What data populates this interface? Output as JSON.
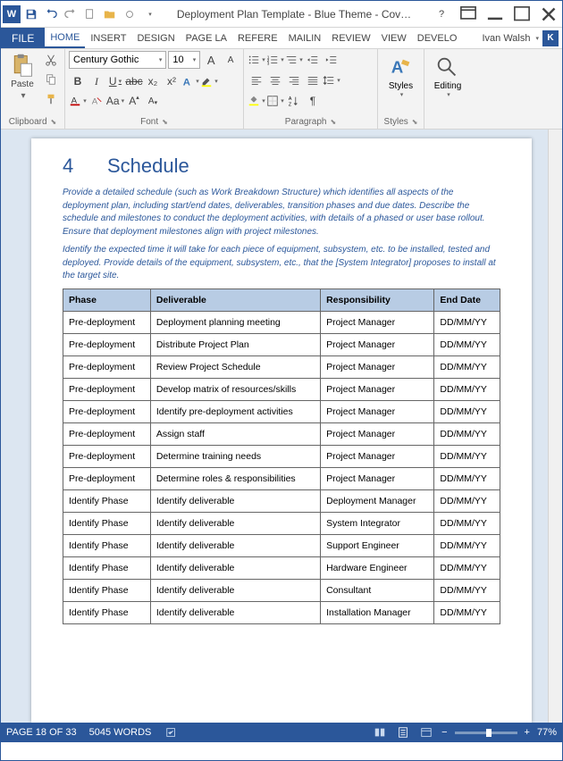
{
  "titlebar": {
    "title": "Deployment Plan Template - Blue Theme - Cov…"
  },
  "ribbon_tabs": {
    "file": "FILE",
    "items": [
      "HOME",
      "INSERT",
      "DESIGN",
      "PAGE LA",
      "REFERE",
      "MAILIN",
      "REVIEW",
      "VIEW",
      "DEVELO"
    ],
    "active_index": 0
  },
  "user": {
    "name": "Ivan Walsh",
    "initial": "K"
  },
  "ribbon": {
    "clipboard": {
      "label": "Clipboard",
      "paste": "Paste"
    },
    "font": {
      "label": "Font",
      "name": "Century Gothic",
      "size": "10",
      "bold": "B",
      "italic": "I",
      "underline": "U",
      "strike": "abc",
      "sub": "x₂",
      "sup": "x²",
      "grow": "A",
      "shrink": "A",
      "case": "Aa"
    },
    "paragraph": {
      "label": "Paragraph"
    },
    "styles": {
      "label": "Styles",
      "btn": "Styles"
    },
    "editing": {
      "label": "",
      "btn": "Editing"
    }
  },
  "document": {
    "heading_num": "4",
    "heading_text": "Schedule",
    "instr1": "Provide a detailed schedule (such as Work Breakdown Structure) which identifies all aspects of the deployment plan, including start/end dates, deliverables, transition phases and due dates. Describe the schedule and milestones to conduct the deployment activities, with details of a phased or user base rollout. Ensure that deployment milestones align with project milestones.",
    "instr2": "Identify the expected time it will take for each piece of equipment, subsystem, etc. to be installed, tested and deployed. Provide details of the equipment, subsystem, etc., that the [System Integrator] proposes to install at the target site.",
    "table": {
      "headers": [
        "Phase",
        "Deliverable",
        "Responsibility",
        "End Date"
      ],
      "rows": [
        [
          "Pre-deployment",
          "Deployment planning meeting",
          "Project Manager",
          "DD/MM/YY"
        ],
        [
          "Pre-deployment",
          "Distribute Project Plan",
          "Project Manager",
          "DD/MM/YY"
        ],
        [
          "Pre-deployment",
          "Review Project Schedule",
          "Project Manager",
          "DD/MM/YY"
        ],
        [
          "Pre-deployment",
          "Develop matrix of resources/skills",
          "Project Manager",
          "DD/MM/YY"
        ],
        [
          "Pre-deployment",
          "Identify pre-deployment activities",
          "Project Manager",
          "DD/MM/YY"
        ],
        [
          "Pre-deployment",
          "Assign staff",
          "Project Manager",
          "DD/MM/YY"
        ],
        [
          "Pre-deployment",
          "Determine training needs",
          "Project Manager",
          "DD/MM/YY"
        ],
        [
          "Pre-deployment",
          "Determine roles & responsibilities",
          "Project Manager",
          "DD/MM/YY"
        ],
        [
          "Identify Phase",
          "Identify deliverable",
          "Deployment Manager",
          "DD/MM/YY"
        ],
        [
          "Identify Phase",
          "Identify deliverable",
          "System Integrator",
          "DD/MM/YY"
        ],
        [
          "Identify Phase",
          "Identify deliverable",
          "Support Engineer",
          "DD/MM/YY"
        ],
        [
          "Identify Phase",
          "Identify deliverable",
          "Hardware Engineer",
          "DD/MM/YY"
        ],
        [
          "Identify Phase",
          "Identify deliverable",
          "Consultant",
          "DD/MM/YY"
        ],
        [
          "Identify Phase",
          "Identify deliverable",
          "Installation Manager",
          "DD/MM/YY"
        ]
      ]
    }
  },
  "statusbar": {
    "page": "PAGE 18 OF 33",
    "words": "5045 WORDS",
    "zoom": "77%"
  }
}
